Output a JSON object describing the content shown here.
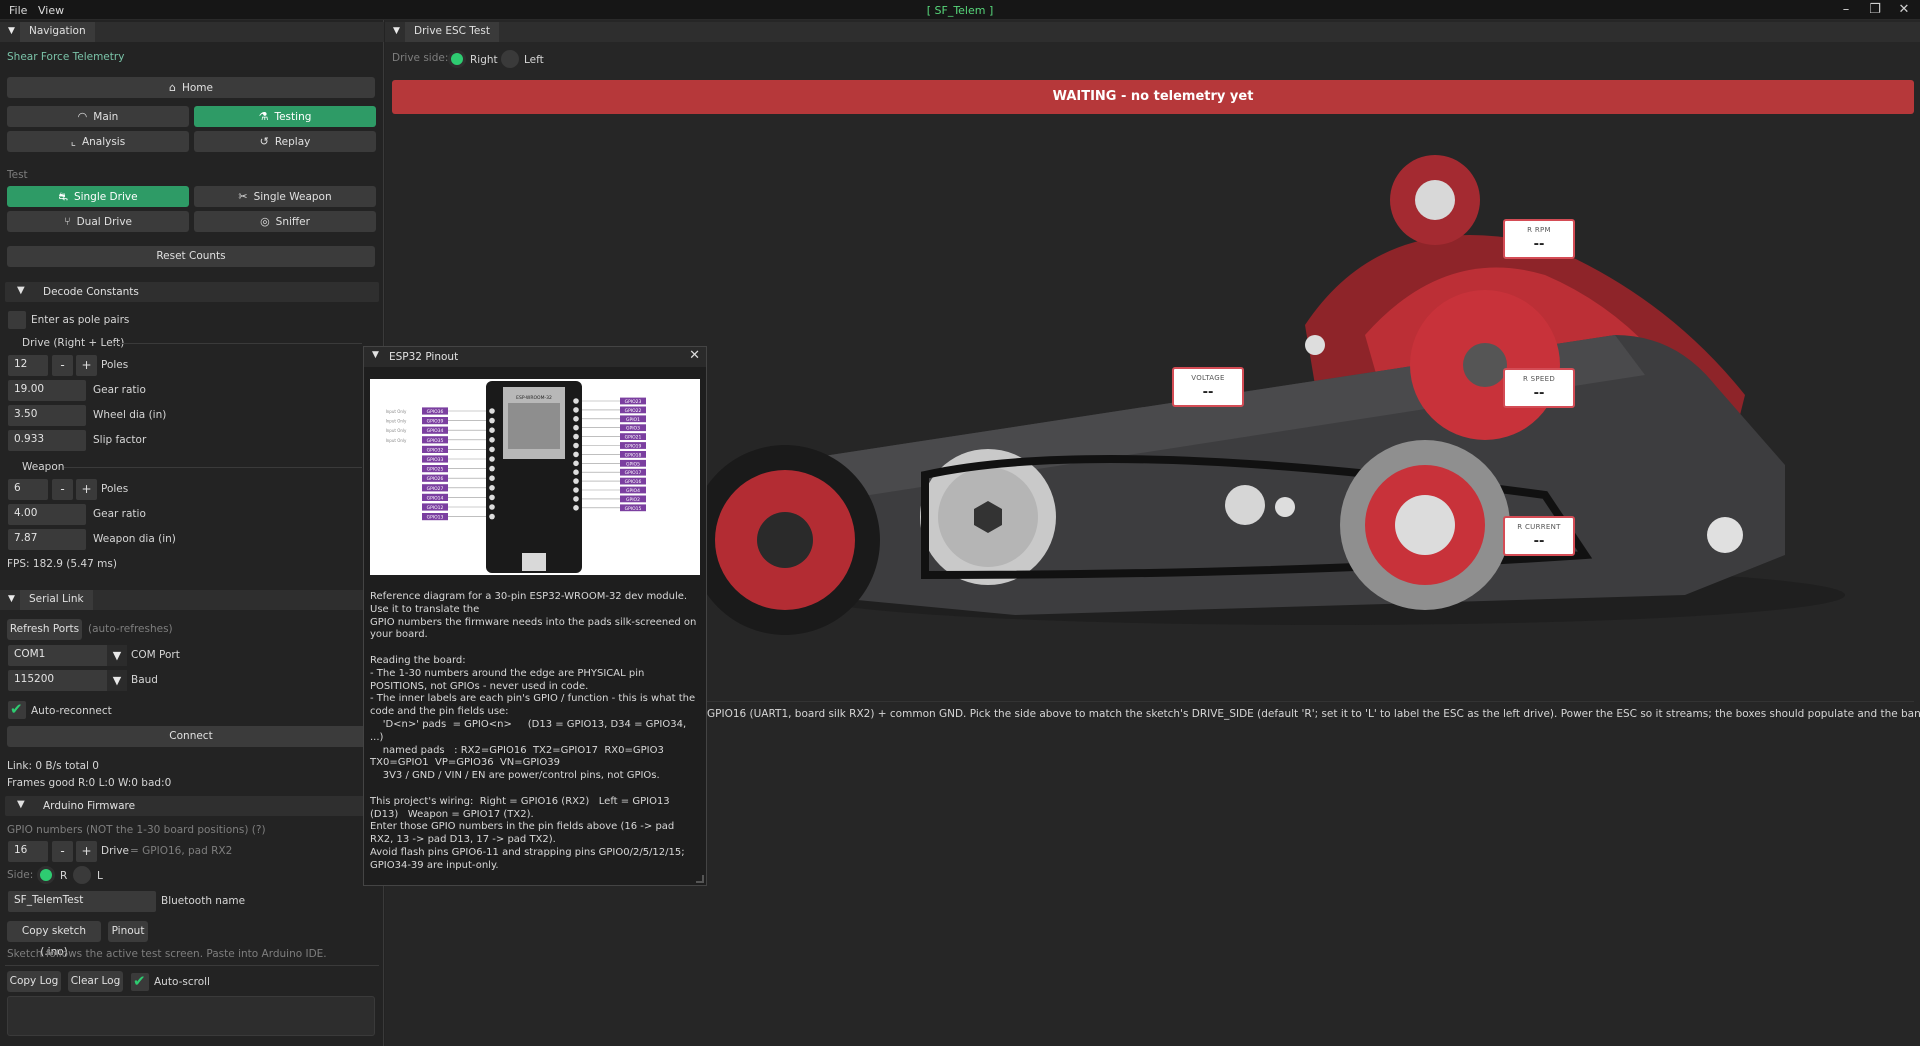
{
  "menu": {
    "file": "File",
    "view": "View",
    "app_title": "[ SF_Telem ]"
  },
  "window_controls": {
    "minimize": "–",
    "maximize": "❐",
    "close": "✕"
  },
  "nav": {
    "tab": "Navigation",
    "section_title": "Shear Force Telemetry",
    "home": "Home",
    "main": "Main",
    "testing": "Testing",
    "analysis": "Analysis",
    "replay": "Replay"
  },
  "test": {
    "label": "Test",
    "single_drive": "Single Drive",
    "single_weapon": "Single Weapon",
    "dual_drive": "Dual Drive",
    "sniffer": "Sniffer",
    "reset_counts": "Reset Counts"
  },
  "decode": {
    "header": "Decode Constants",
    "pole_pairs_label": "Enter as pole pairs",
    "drive_header": "Drive (Right + Left)",
    "drive_poles": "12",
    "poles_label": "Poles",
    "drive_gear_ratio": "19.00",
    "gear_ratio_label": "Gear ratio",
    "wheel_dia": "3.50",
    "wheel_dia_label": "Wheel dia (in)",
    "slip": "0.933",
    "slip_label": "Slip factor",
    "weapon_header": "Weapon",
    "weapon_poles": "6",
    "weapon_gear_ratio": "4.00",
    "weapon_dia": "7.87",
    "weapon_dia_label": "Weapon dia (in)",
    "minus": "-",
    "plus": "+"
  },
  "fps": "FPS: 182.9 (5.47 ms)",
  "serial": {
    "tab": "Serial Link",
    "refresh": "Refresh Ports",
    "auto_refresh": "(auto-refreshes)",
    "com_value": "COM1",
    "com_label": "COM Port",
    "baud_value": "115200",
    "baud_label": "Baud",
    "auto_reconnect": "Auto-reconnect",
    "connect": "Connect",
    "link_stats": "Link: 0 B/s   total 0",
    "frames": "Frames good R:0 L:0 W:0   bad:0"
  },
  "firmware": {
    "header": "Arduino Firmware",
    "gpio_note": "GPIO numbers (NOT the 1-30 board positions)  (?)",
    "drive_gpio": "16",
    "drive_label": "Drive",
    "drive_hint": "= GPIO16, pad RX2",
    "side_label": "Side:",
    "side_r": "R",
    "side_l": "L",
    "bt_name": "SF_TelemTest",
    "bt_label": "Bluetooth name",
    "copy_sketch": "Copy sketch (.ino)",
    "pinout": "Pinout",
    "sketch_note": "Sketch follows the active test screen. Paste into Arduino IDE."
  },
  "log": {
    "copy": "Copy Log",
    "clear": "Clear Log",
    "autoscroll": "Auto-scroll"
  },
  "drive_esc": {
    "tab": "Drive ESC Test",
    "side_label": "Drive side:",
    "right": "Right",
    "left": "Left",
    "banner": "WAITING - no telemetry yet",
    "instructions": "GPIO16 (UART1, board silk RX2) + common GND. Pick the side above to match the sketch's DRIVE_SIDE (default 'R'; set it to 'L' to label the ESC as the left drive). Power the ESC so it streams; the boxes should populate and the banner turn green."
  },
  "telemetry": {
    "rpm_label": "R RPM",
    "rpm_value": "--",
    "voltage_label": "VOLTAGE",
    "voltage_value": "--",
    "speed_label": "R SPEED",
    "speed_value": "--",
    "current_label": "R CURRENT",
    "current_value": "--"
  },
  "popup": {
    "title": "ESP32 Pinout",
    "close": "✕",
    "body": "Reference diagram for a 30-pin ESP32-WROOM-32 dev module. Use it to translate the\nGPIO numbers the firmware needs into the pads silk-screened on your board.\n\nReading the board:\n- The 1-30 numbers around the edge are PHYSICAL pin POSITIONS, not GPIOs - never used in code.\n- The inner labels are each pin's GPIO / function - this is what the code and the pin fields use:\n    'D<n>' pads  = GPIO<n>     (D13 = GPIO13, D34 = GPIO34, ...)\n    named pads   : RX2=GPIO16  TX2=GPIO17  RX0=GPIO3  TX0=GPIO1  VP=GPIO36  VN=GPIO39\n    3V3 / GND / VIN / EN are power/control pins, not GPIOs.\n\nThis project's wiring:  Right = GPIO16 (RX2)   Left = GPIO13 (D13)   Weapon = GPIO17 (TX2).\nEnter those GPIO numbers in the pin fields above (16 -> pad RX2, 13 -> pad D13, 17 -> pad TX2).\nAvoid flash pins GPIO6-11 and strapping pins GPIO0/2/5/12/15; GPIO34-39 are input-only.",
    "left_pins": [
      "GPIO36",
      "GPIO39",
      "GPIO34",
      "GPIO35",
      "GPIO32",
      "GPIO33",
      "GPIO25",
      "GPIO26",
      "GPIO27",
      "GPIO14",
      "GPIO12",
      "GPIO13"
    ],
    "right_pins": [
      "GPIO23",
      "GPIO22",
      "GPIO1",
      "GPIO3",
      "GPIO21",
      "GPIO19",
      "GPIO18",
      "GPIO5",
      "GPIO17",
      "GPIO16",
      "GPIO4",
      "GPIO2",
      "GPIO15"
    ],
    "input_only": "Input Only",
    "module_label": "ESP-WROOM-32"
  },
  "colors": {
    "accent": "#2e9b66",
    "banner": "#b6383a",
    "brand_text": "#57d67a",
    "robot_red": "#c8323a"
  }
}
